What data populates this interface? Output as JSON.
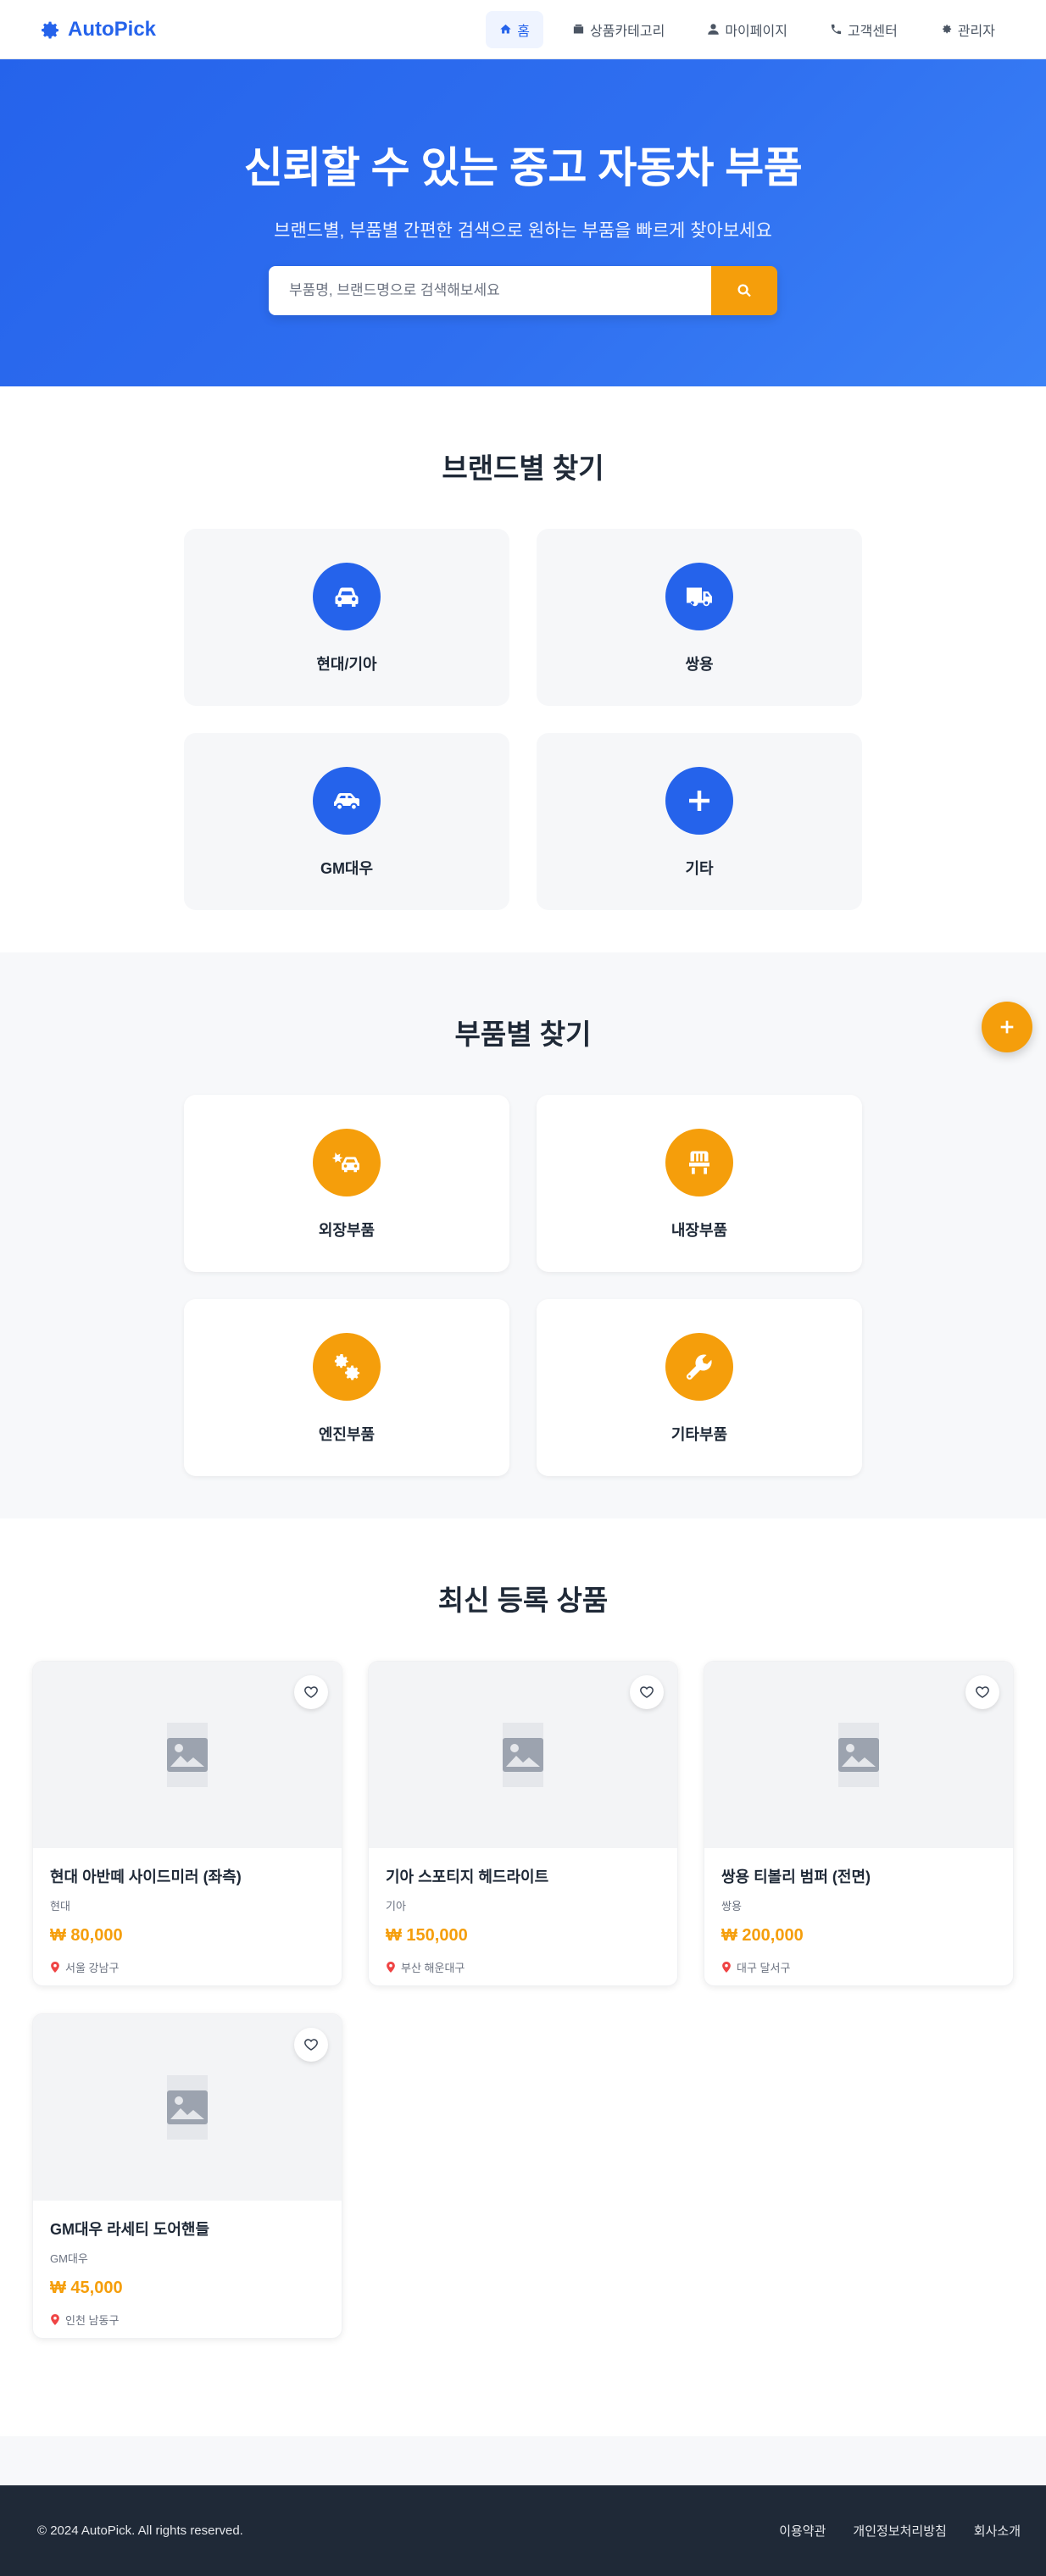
{
  "header": {
    "brand": "AutoPick",
    "nav": [
      {
        "label": "홈",
        "icon": "home-icon",
        "active": true
      },
      {
        "label": "상품카테고리",
        "icon": "category-icon"
      },
      {
        "label": "마이페이지",
        "icon": "user-icon"
      },
      {
        "label": "고객센터",
        "icon": "phone-icon"
      },
      {
        "label": "관리자",
        "icon": "gear-icon"
      }
    ]
  },
  "hero": {
    "title": "신뢰할 수 있는 중고 자동차 부품",
    "subtitle": "브랜드별, 부품별 간편한 검색으로 원하는 부품을 빠르게 찾아보세요",
    "search_placeholder": "부품명, 브랜드명으로 검색해보세요"
  },
  "brands": {
    "title": "브랜드별 찾기",
    "items": [
      {
        "label": "현대/기아",
        "icon": "car-icon"
      },
      {
        "label": "쌍용",
        "icon": "truck-icon"
      },
      {
        "label": "GM대우",
        "icon": "car-side-icon"
      },
      {
        "label": "기타",
        "icon": "plus-icon"
      }
    ]
  },
  "parts": {
    "title": "부품별 찾기",
    "items": [
      {
        "label": "외장부품",
        "icon": "car-crash-icon"
      },
      {
        "label": "내장부품",
        "icon": "chair-icon"
      },
      {
        "label": "엔진부품",
        "icon": "cogs-icon"
      },
      {
        "label": "기타부품",
        "icon": "wrench-icon"
      }
    ]
  },
  "latest": {
    "title": "최신 등록 상품",
    "products": [
      {
        "title": "현대 아반떼 사이드미러 (좌측)",
        "brand": "현대",
        "price": "₩ 80,000",
        "location": "서울 강남구"
      },
      {
        "title": "기아 스포티지 헤드라이트",
        "brand": "기아",
        "price": "₩ 150,000",
        "location": "부산 해운대구"
      },
      {
        "title": "쌍용 티볼리 범퍼 (전면)",
        "brand": "쌍용",
        "price": "₩ 200,000",
        "location": "대구 달서구"
      },
      {
        "title": "GM대우 라세티 도어핸들",
        "brand": "GM대우",
        "price": "₩ 45,000",
        "location": "인천 남동구"
      }
    ]
  },
  "footer": {
    "copyright": "© 2024 AutoPick. All rights reserved.",
    "links": [
      "이용약관",
      "개인정보처리방침",
      "회사소개"
    ]
  },
  "colors": {
    "primary": "#2563eb",
    "accent": "#f59e0b",
    "footer_bg": "#1f2937"
  }
}
